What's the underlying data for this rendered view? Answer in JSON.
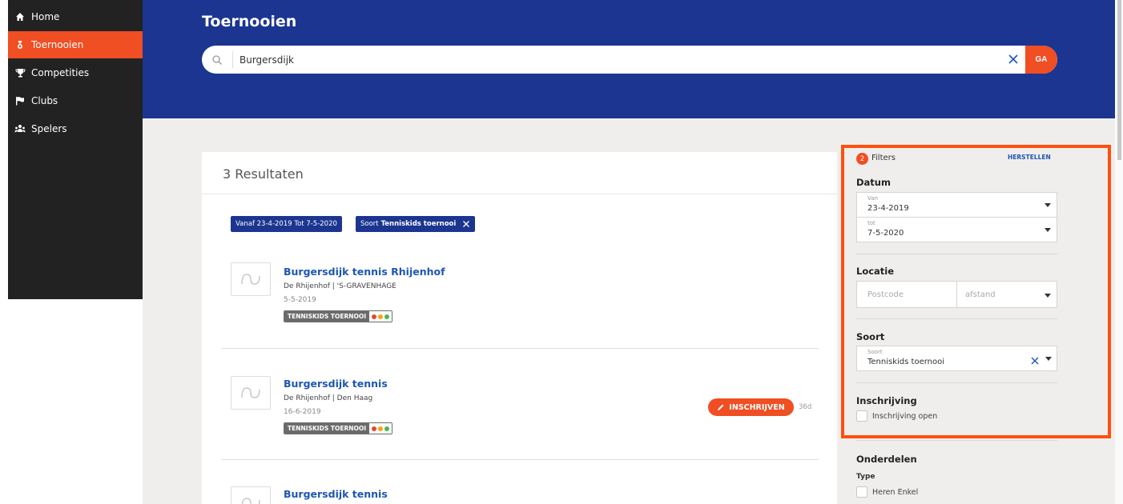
{
  "sidebar": {
    "items": [
      {
        "label": "Home",
        "icon": "home-icon",
        "active": false
      },
      {
        "label": "Toernooien",
        "icon": "trophy-ribbon-icon",
        "active": true
      },
      {
        "label": "Competities",
        "icon": "trophy-icon",
        "active": false
      },
      {
        "label": "Clubs",
        "icon": "flag-icon",
        "active": false
      },
      {
        "label": "Spelers",
        "icon": "players-icon",
        "active": false
      }
    ]
  },
  "header": {
    "title": "Toernooien",
    "search": {
      "value": "Burgersdijk",
      "go_label": "GA"
    }
  },
  "results": {
    "count_label": "3 Resultaten",
    "chips": [
      {
        "prefix": "Vanaf 23-4-2019 Tot 7-5-2020",
        "value": ""
      },
      {
        "prefix": "Soort",
        "value": "Tenniskids toernooi"
      }
    ],
    "items": [
      {
        "title": "Burgersdijk tennis Rhijenhof",
        "location": "De Rhijenhof | 'S-GRAVENHAGE",
        "date": "5-5-2019",
        "badge": "TENNISKIDS TOERNOOI"
      },
      {
        "title": "Burgersdijk tennis",
        "location": "De Rhijenhof | Den Haag",
        "date": "16-6-2019",
        "badge": "TENNISKIDS TOERNOOI",
        "enroll_label": "INSCHRIJVEN",
        "days_left": "36d"
      },
      {
        "title": "Burgersdijk tennis",
        "location": "",
        "date": "",
        "badge": ""
      }
    ]
  },
  "filters": {
    "count": "2",
    "label": "Filters",
    "reset_label": "HERSTELLEN",
    "datum": {
      "title": "Datum",
      "from_label": "Van",
      "from_value": "23-4-2019",
      "to_label": "tot",
      "to_value": "7-5-2020"
    },
    "locatie": {
      "title": "Locatie",
      "postcode_placeholder": "Postcode",
      "distance_placeholder": "afstand"
    },
    "soort": {
      "title": "Soort",
      "field_label": "Soort",
      "value": "Tenniskids toernooi"
    },
    "inschrijving": {
      "title": "Inschrijving",
      "option": "Inschrijving open"
    },
    "onderdelen": {
      "title": "Onderdelen",
      "type_label": "Type",
      "option": "Heren Enkel"
    }
  },
  "colors": {
    "brand_blue": "#1b3590",
    "accent_orange": "#f04e23",
    "highlight": "#ff4f0f",
    "dot_red": "#e8452c",
    "dot_orange": "#f7a21b",
    "dot_green": "#4cb848"
  }
}
